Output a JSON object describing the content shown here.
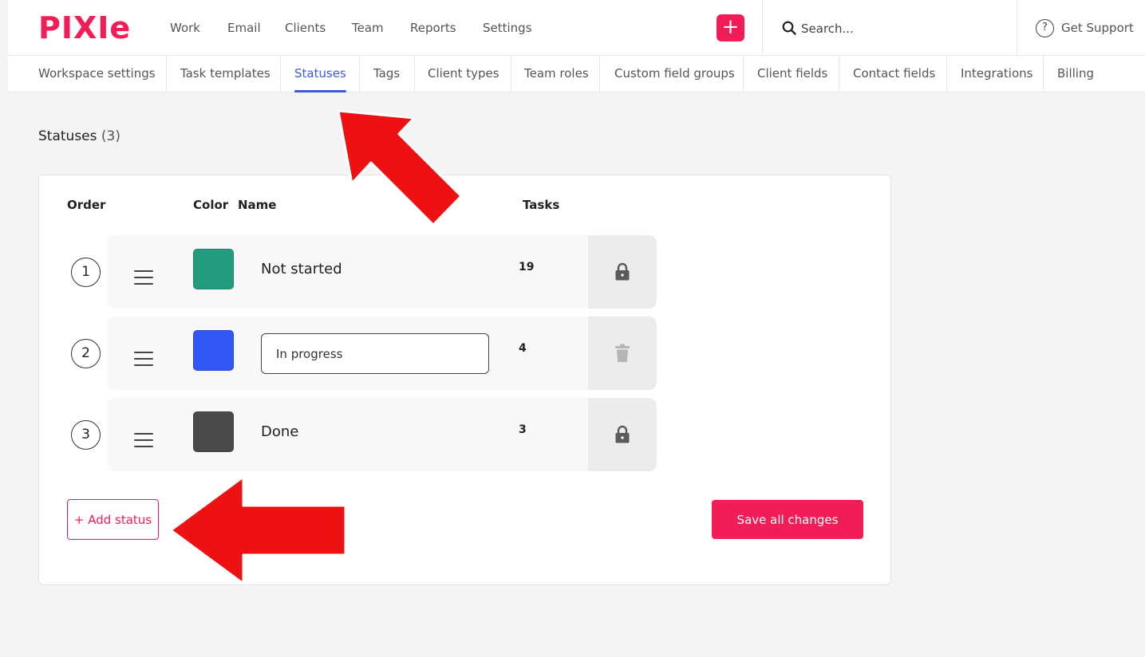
{
  "brand": {
    "logo_text": "PIXIe",
    "accent": "#f21d56",
    "link_blue": "#3b5bdb"
  },
  "topnav": {
    "items": [
      {
        "label": "Work"
      },
      {
        "label": "Email"
      },
      {
        "label": "Clients"
      },
      {
        "label": "Team"
      },
      {
        "label": "Reports"
      },
      {
        "label": "Settings"
      }
    ],
    "add_label": "+",
    "search_placeholder": "Search...",
    "support_icon_text": "?",
    "support_label": "Get Support"
  },
  "subtabs": [
    {
      "label": "Workspace settings"
    },
    {
      "label": "Task templates"
    },
    {
      "label": "Statuses",
      "active": true
    },
    {
      "label": "Tags"
    },
    {
      "label": "Client types"
    },
    {
      "label": "Team roles"
    },
    {
      "label": "Custom field groups"
    },
    {
      "label": "Client fields"
    },
    {
      "label": "Contact fields"
    },
    {
      "label": "Integrations"
    },
    {
      "label": "Billing"
    }
  ],
  "page": {
    "title": "Statuses",
    "count": "(3)"
  },
  "table": {
    "headers": {
      "order": "Order",
      "color": "Color",
      "name": "Name",
      "tasks": "Tasks"
    },
    "rows": [
      {
        "order": "1",
        "color": "#219c7f",
        "name": "Not started",
        "tasks": "19",
        "action_icon": "lock-icon",
        "editing": false
      },
      {
        "order": "2",
        "color": "#3158f5",
        "name": "In progress",
        "tasks": "4",
        "action_icon": "trash-icon",
        "editing": true
      },
      {
        "order": "3",
        "color": "#4a4a4a",
        "name": "Done",
        "tasks": "3",
        "action_icon": "lock-icon",
        "editing": false
      }
    ]
  },
  "actions": {
    "add_status": "+ Add status",
    "save_all": "Save all changes"
  },
  "annotations": {
    "arrow_color": "#ee1111"
  }
}
